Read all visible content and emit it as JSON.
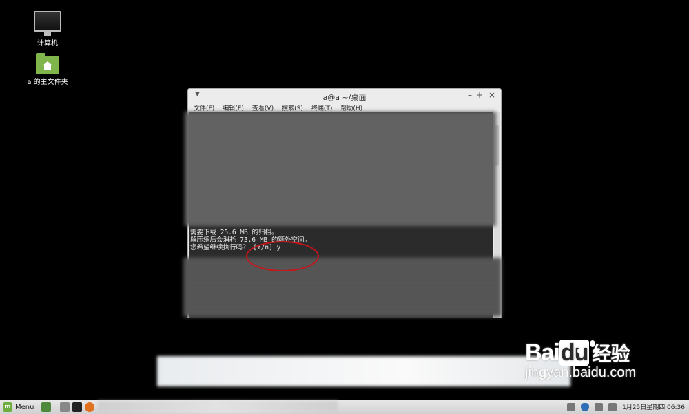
{
  "desktop": {
    "icons": [
      {
        "label": "计算机"
      },
      {
        "label": "a 的主文件夹"
      }
    ]
  },
  "terminal": {
    "title": "a@a ~/桌面",
    "menu": [
      "文件(F)",
      "编辑(E)",
      "查看(V)",
      "搜索(S)",
      "终端(T)",
      "帮助(H)"
    ],
    "lines": [
      "需要下载 25.6 MB 的归档。",
      "解压缩后会消耗 73.6 MB 的额外空间。",
      "您希望继续执行吗？ [Y/n] y"
    ]
  },
  "taskbar": {
    "menu_label": "Menu",
    "clock": "1月25日星期四 06:36"
  },
  "watermark": {
    "brand_left": "Bai",
    "brand_du": "du",
    "brand_right": "经验",
    "url": "jingyan.baidu.com"
  },
  "colors": {
    "highlight_circle": "#c8141a",
    "mint_green": "#6fae3e"
  }
}
